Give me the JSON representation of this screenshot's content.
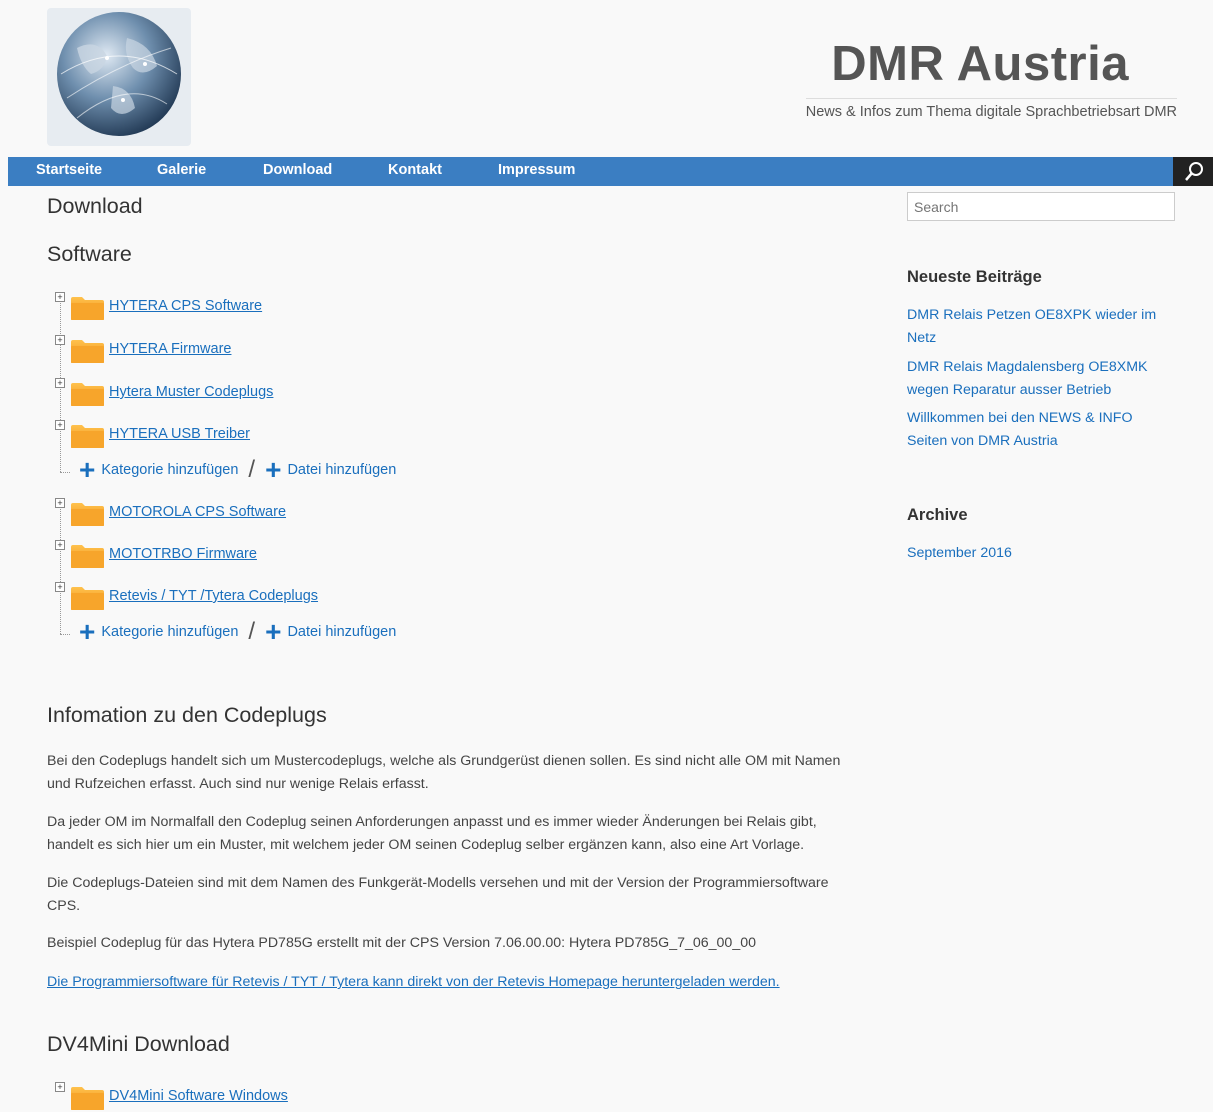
{
  "header": {
    "site_title": "DMR Austria",
    "site_description": "News & Infos zum Thema digitale Sprachbetriebsart DMR"
  },
  "nav": {
    "items": [
      "Startseite",
      "Galerie",
      "Download",
      "Kontakt",
      "Impressum"
    ]
  },
  "main": {
    "page_title": "Download",
    "software_heading": "Software",
    "tree_hytera": [
      "HYTERA CPS Software",
      "HYTERA Firmware",
      "Hytera Muster Codeplugs",
      "HYTERA USB Treiber"
    ],
    "tree_other": [
      "MOTOROLA CPS Software",
      "MOTOTRBO Firmware",
      "Retevis / TYT /Tytera Codeplugs"
    ],
    "add_category": "Kategorie hinzufügen",
    "add_separator": "/",
    "add_file": "Datei hinzufügen",
    "info_heading": "Infomation zu den Codeplugs",
    "paragraphs": [
      "Bei den Codeplugs handelt sich um Mustercodeplugs, welche als Grundgerüst dienen sollen. Es sind nicht alle OM mit Namen und Rufzeichen erfasst. Auch sind nur wenige Relais erfasst.",
      "Da jeder OM im Normalfall den Codeplug seinen Anforderungen anpasst und es immer wieder Änderungen bei Relais gibt, handelt es sich hier um ein Muster, mit welchem jeder OM seinen Codeplug selber ergänzen kann, also eine Art Vorlage.",
      "Die Codeplugs-Dateien sind mit dem Namen des Funkgerät-Modells versehen und mit der Version der Programmiersoftware CPS.",
      "Beispiel Codeplug für das Hytera PD785G erstellt mit der CPS Version 7.06.00.00: Hytera PD785G_7_06_00_00"
    ],
    "retevis_link": "Die Programmiersoftware für Retevis / TYT / Tytera kann direkt von der Retevis Homepage heruntergeladen werden.",
    "dv4mini_heading": "DV4Mini Download",
    "dv4mini_item": "DV4Mini Software Windows"
  },
  "sidebar": {
    "search_placeholder": "Search",
    "recent_title": "Neueste Beiträge",
    "recent_posts": [
      "DMR Relais Petzen OE8XPK wieder im Netz",
      "DMR Relais Magdalensberg OE8XMK wegen Reparatur ausser Betrieb",
      "Willkommen bei den NEWS & INFO Seiten von DMR Austria"
    ],
    "archive_title": "Archive",
    "archive_items": [
      "September 2016"
    ]
  },
  "colors": {
    "nav_bg": "#3b7ec2",
    "link": "#1a6fbd",
    "folder": "#f5a623"
  }
}
